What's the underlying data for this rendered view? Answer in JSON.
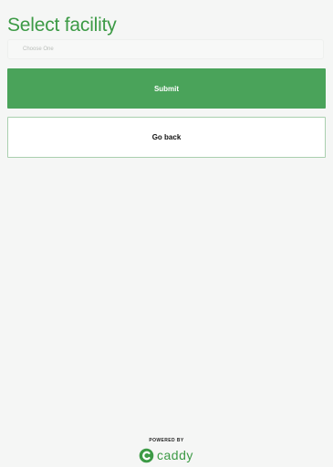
{
  "page": {
    "title": "Select facility"
  },
  "facility_select": {
    "placeholder": "Choose One"
  },
  "actions": {
    "submit_label": "Submit",
    "back_label": "Go back"
  },
  "footer": {
    "powered_by": "POWERED BY",
    "brand_name": "caddy",
    "brand_icon": "caddy-logo-icon"
  },
  "colors": {
    "accent": "#3c9a45",
    "submit_background": "#4aa35a",
    "background": "#f5f6f5"
  }
}
